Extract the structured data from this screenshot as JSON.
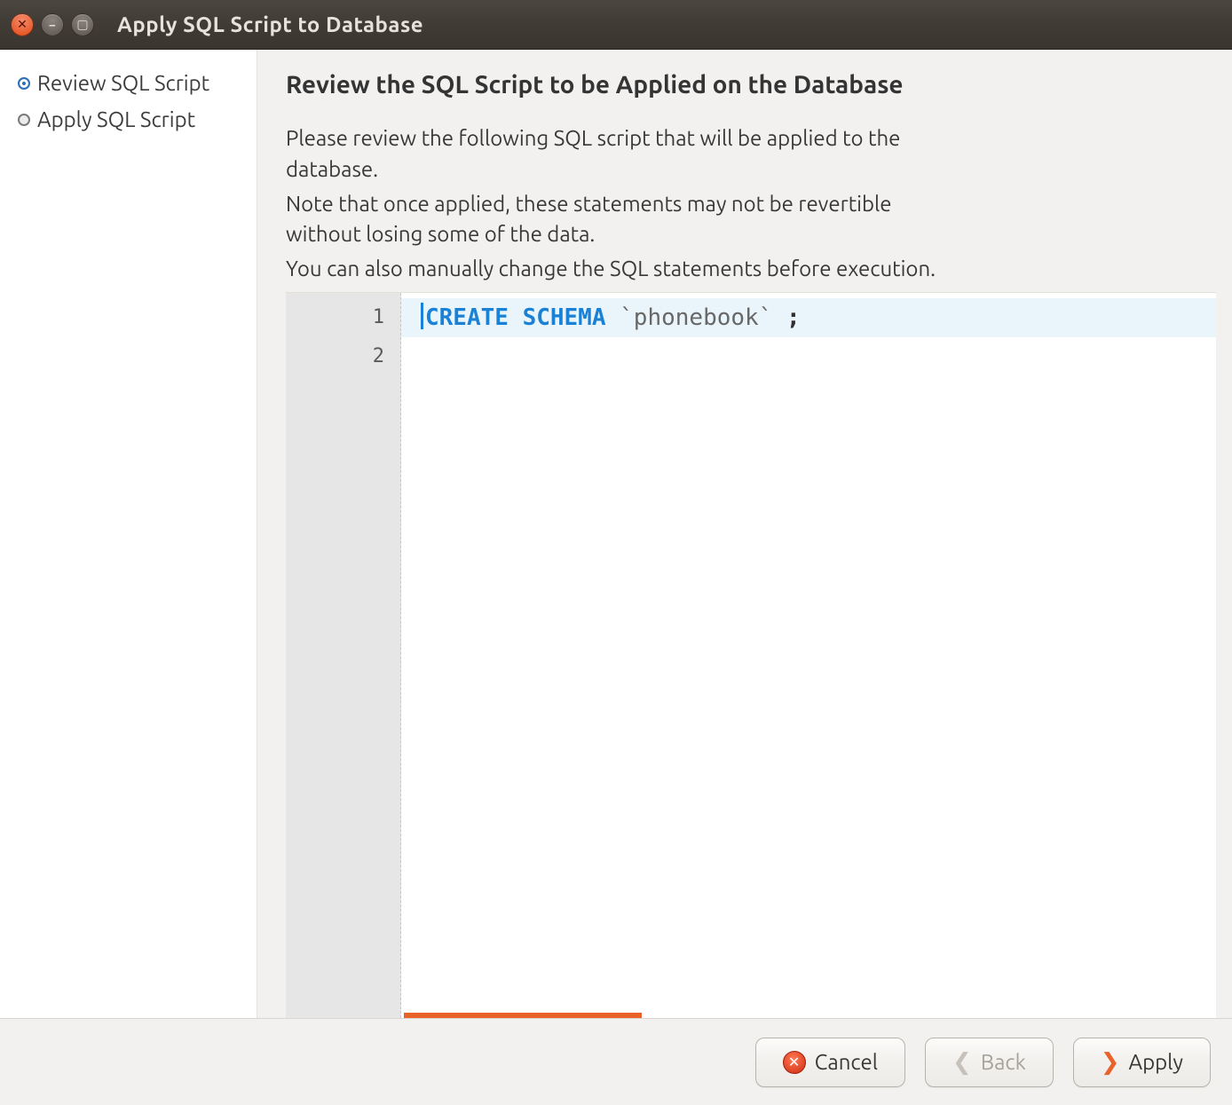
{
  "window": {
    "title": "Apply SQL Script to Database"
  },
  "sidebar": {
    "steps": [
      {
        "label": "Review SQL Script",
        "active": true
      },
      {
        "label": "Apply SQL Script",
        "active": false
      }
    ]
  },
  "main": {
    "heading": "Review the SQL Script to be Applied on the Database",
    "instructions_l1": "Please review the following SQL script that will be applied to the database.",
    "instructions_l2": "Note that once applied, these statements may not be revertible without losing some of the data.",
    "instructions_l3": "You can also manually change the SQL statements before execution."
  },
  "editor": {
    "gutter": [
      "1",
      "2"
    ],
    "sql": {
      "keyword": "CREATE SCHEMA",
      "identifier": "`phonebook`",
      "terminator": ";"
    }
  },
  "footer": {
    "cancel": "Cancel",
    "back": "Back",
    "apply": "Apply"
  }
}
